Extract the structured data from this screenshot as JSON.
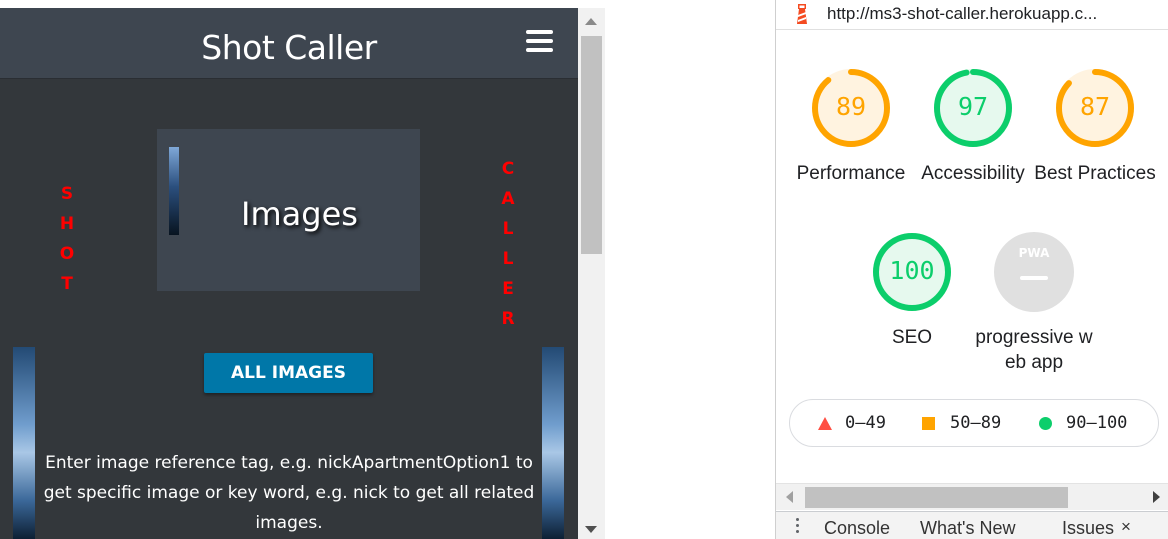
{
  "preview": {
    "brand": "Shot Caller",
    "left_word": [
      "S",
      "H",
      "O",
      "T"
    ],
    "right_word": [
      "C",
      "A",
      "L",
      "L",
      "E",
      "R"
    ],
    "card_title": "Images",
    "button_label": "ALL IMAGES",
    "description": "Enter image reference tag, e.g. nickApartmentOption1 to get specific image or key word, e.g. nick to get all related images."
  },
  "devtools": {
    "url": "http://ms3-shot-caller.herokuapp.c...",
    "scores": [
      {
        "value": "89",
        "label": "Performance",
        "color": "#ffa400",
        "bg": "#fff3e0",
        "fraction": 0.89
      },
      {
        "value": "97",
        "label": "Accessibility",
        "color": "#0cce6b",
        "bg": "#e6f9ee",
        "fraction": 0.97
      },
      {
        "value": "87",
        "label": "Best Practices",
        "color": "#ffa400",
        "bg": "#fff3e0",
        "fraction": 0.87
      },
      {
        "value": "100",
        "label": "SEO",
        "color": "#0cce6b",
        "bg": "#e6f9ee",
        "fraction": 1.0
      }
    ],
    "pwa": {
      "badge": "PWA",
      "label": "progressive web app"
    },
    "legend": {
      "fail": "0–49",
      "average": "50–89",
      "pass": "90–100"
    },
    "drawer_tabs": [
      "Console",
      "What's New",
      "Issues"
    ],
    "close_glyph": "×"
  },
  "colors": {
    "fail": "#ff4e42",
    "average": "#ffa400",
    "pass": "#0cce6b",
    "accent_button": "#0077a8",
    "brand_red": "#ff0000"
  }
}
